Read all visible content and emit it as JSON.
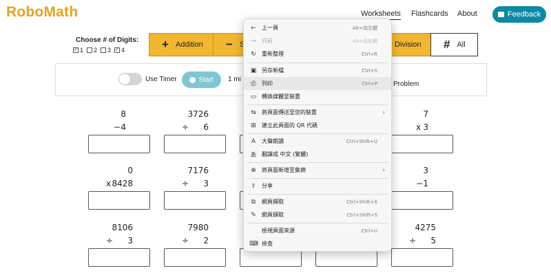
{
  "header": {
    "logo_robo": "Robo",
    "logo_math": "Math",
    "nav": [
      "Worksheets",
      "Flashcards",
      "About"
    ],
    "feedback_label": "Feedback"
  },
  "digits": {
    "title": "Choose # of Digits:",
    "options": [
      {
        "label": "1",
        "checked": true
      },
      {
        "label": "2",
        "checked": false
      },
      {
        "label": "3",
        "checked": false
      },
      {
        "label": "4",
        "checked": true
      }
    ]
  },
  "operations": [
    {
      "symbol": "+",
      "label": "Addition"
    },
    {
      "symbol": "−",
      "label": "S"
    },
    {
      "symbol": "",
      "label": "Division"
    },
    {
      "symbol": "#",
      "label": "All"
    }
  ],
  "timer": {
    "use_timer_label": "Use Timer",
    "start_label": "Start",
    "minutes_text": "1 mi",
    "problem_text": "Problem"
  },
  "problems": [
    {
      "top": "8",
      "op": "−",
      "bottom": "4"
    },
    {
      "top": "3726",
      "op": "÷",
      "bottom": "6"
    },
    {
      "top": "7",
      "op": "x",
      "bottom": "3"
    },
    {
      "top": "0",
      "op": "x",
      "bottom": "8428"
    },
    {
      "top": "7176",
      "op": "÷",
      "bottom": "3"
    },
    {
      "top": "3",
      "op": "−",
      "bottom": "1"
    },
    {
      "top": "8106",
      "op": "÷",
      "bottom": "3"
    },
    {
      "top": "7980",
      "op": "÷",
      "bottom": "2"
    },
    {
      "top": "4275",
      "op": "÷",
      "bottom": "5"
    }
  ],
  "context_menu": {
    "items": [
      {
        "icon": "←",
        "label": "上一頁",
        "shortcut": "Alt+向左鍵",
        "disabled": false
      },
      {
        "icon": "→",
        "label": "向前",
        "shortcut": "Alt+向右鍵",
        "disabled": true
      },
      {
        "icon": "↻",
        "label": "重新整理",
        "shortcut": "Ctrl+R",
        "disabled": false
      },
      {
        "icon": "▣",
        "label": "另存新檔",
        "shortcut": "Ctrl+S",
        "disabled": false
      },
      {
        "icon": "⎙",
        "label": "列印",
        "shortcut": "Ctrl+P",
        "disabled": false
      },
      {
        "icon": "▭",
        "label": "轉換媒體至裝置",
        "shortcut": "",
        "disabled": false
      },
      {
        "icon": "⇆",
        "label": "將頁面傳送至您的裝置",
        "shortcut": "",
        "disabled": false
      },
      {
        "icon": "⊞",
        "label": "建立此頁面的 QR 代碼",
        "shortcut": "",
        "disabled": false
      },
      {
        "icon": "A",
        "label": "大聲朗讀",
        "shortcut": "Ctrl+Shift+U",
        "disabled": false
      },
      {
        "icon": "あ",
        "label": "翻譯成 中文 (繁體)",
        "shortcut": "",
        "disabled": false
      },
      {
        "icon": "⊕",
        "label": "將頁面新增至集錦",
        "shortcut": "",
        "disabled": false
      },
      {
        "icon": "⇪",
        "label": "分享",
        "shortcut": "",
        "disabled": false
      },
      {
        "icon": "⧉",
        "label": "網頁擷取",
        "shortcut": "Ctrl+Shift+X",
        "disabled": false
      },
      {
        "icon": "✎",
        "label": "網頁擷取",
        "shortcut": "Ctrl+Shift+S",
        "disabled": false
      },
      {
        "icon": "",
        "label": "檢視頁面來源",
        "shortcut": "Ctrl+U",
        "disabled": false
      },
      {
        "icon": "⌨",
        "label": "檢查",
        "shortcut": "",
        "disabled": false
      }
    ]
  },
  "colors": {
    "brand_orange": "#e7a21d",
    "feedback_teal": "#0c8aa5",
    "op_yellow": "#f2b731",
    "start_blue": "#7fc6d3"
  }
}
